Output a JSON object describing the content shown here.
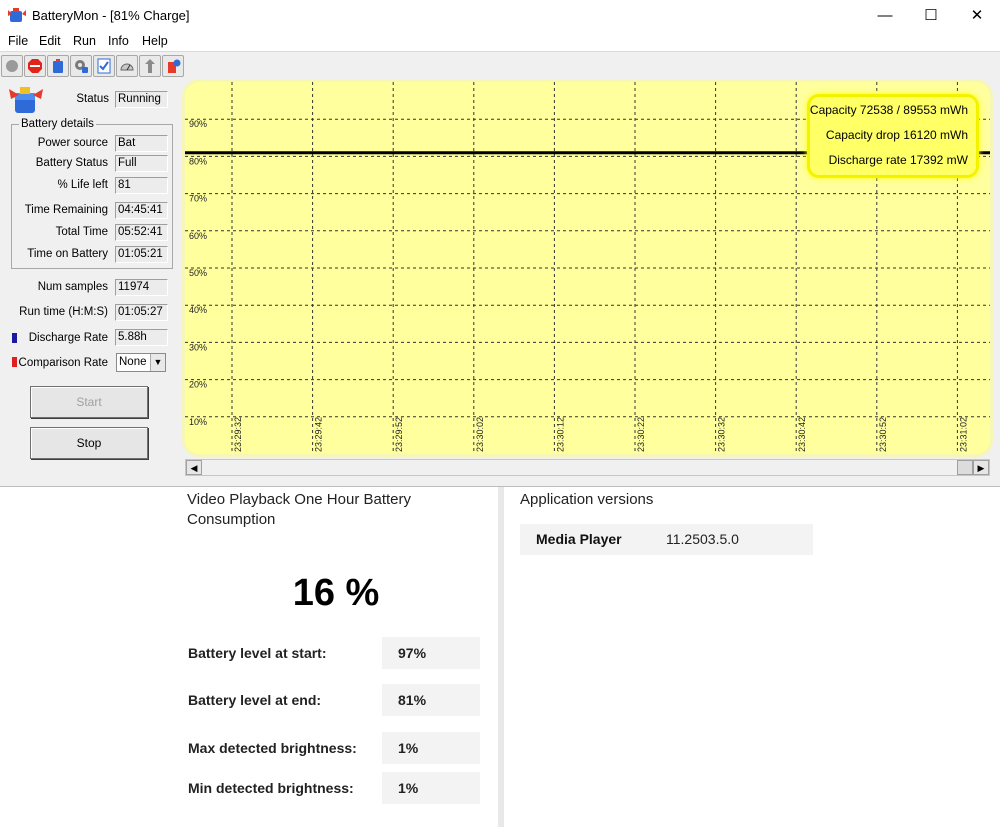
{
  "window": {
    "title": "BatteryMon - [81% Charge]",
    "controls": {
      "minimize": "—",
      "maximize": "☐",
      "close": "✕"
    }
  },
  "menu": [
    "File",
    "Edit",
    "Run",
    "Info",
    "Help"
  ],
  "toolbar": [
    "record-icon",
    "stop-icon",
    "battery-icon",
    "gear-icon",
    "checklist-icon",
    "gauge-icon",
    "arrow-icon",
    "battery-info-icon"
  ],
  "status": {
    "label": "Status",
    "value": "Running"
  },
  "details": {
    "title": "Battery details",
    "rows": [
      {
        "label": "Power source",
        "value": "Bat"
      },
      {
        "label": "Battery Status",
        "value": "Full"
      },
      {
        "label": "% Life left",
        "value": "81"
      },
      {
        "label": "Time Remaining",
        "value": "04:45:41"
      },
      {
        "label": "Total Time",
        "value": "05:52:41"
      },
      {
        "label": "Time on Battery",
        "value": "01:05:21"
      }
    ]
  },
  "stats": {
    "num_samples": {
      "label": "Num samples",
      "value": "11974"
    },
    "run_time": {
      "label": "Run time (H:M:S)",
      "value": "01:05:27"
    },
    "discharge_rate": {
      "label": "Discharge Rate",
      "value": "5.88h",
      "color": "#1a1aa0"
    },
    "comparison_rate": {
      "label": "Comparison Rate",
      "value": "None",
      "color": "#e02020"
    }
  },
  "buttons": {
    "start": "Start",
    "stop": "Stop"
  },
  "chart_data": {
    "type": "line",
    "y_tick_labels": [
      "90%",
      "80%",
      "70%",
      "60%",
      "50%",
      "40%",
      "30%",
      "20%",
      "10%"
    ],
    "x_tick_labels": [
      "23:29:32",
      "23:29:42",
      "23:29:52",
      "23:30:02",
      "23:30:12",
      "23:30:22",
      "23:30:32",
      "23:30:42",
      "23:30:52",
      "23:31:02"
    ],
    "ylim": [
      0,
      100
    ],
    "grid": true,
    "background": "#ffff9e",
    "series": [
      {
        "color": "#000000",
        "values": [
          81,
          81,
          81,
          81,
          81,
          81,
          81,
          81,
          81,
          81,
          81
        ]
      }
    ],
    "annotations": [
      "Capacity 72538 / 89553 mWh",
      "Capacity drop 16120 mWh",
      "Discharge rate 17392 mW"
    ]
  },
  "scroll": {
    "left": "◀",
    "right": "▶",
    "dropdown": "▼"
  },
  "report": {
    "title": "Video Playback One Hour Battery Consumption",
    "percentage": "16 %",
    "rows": [
      {
        "label": "Battery level at start:",
        "value": "97%"
      },
      {
        "label": "Battery level at end:",
        "value": "81%"
      },
      {
        "label": "Max detected brightness:",
        "value": "1%"
      },
      {
        "label": "Min detected brightness:",
        "value": "1%"
      }
    ],
    "versions_title": "Application versions",
    "versions": [
      {
        "name": "Media Player",
        "version": "11.2503.5.0"
      }
    ]
  }
}
